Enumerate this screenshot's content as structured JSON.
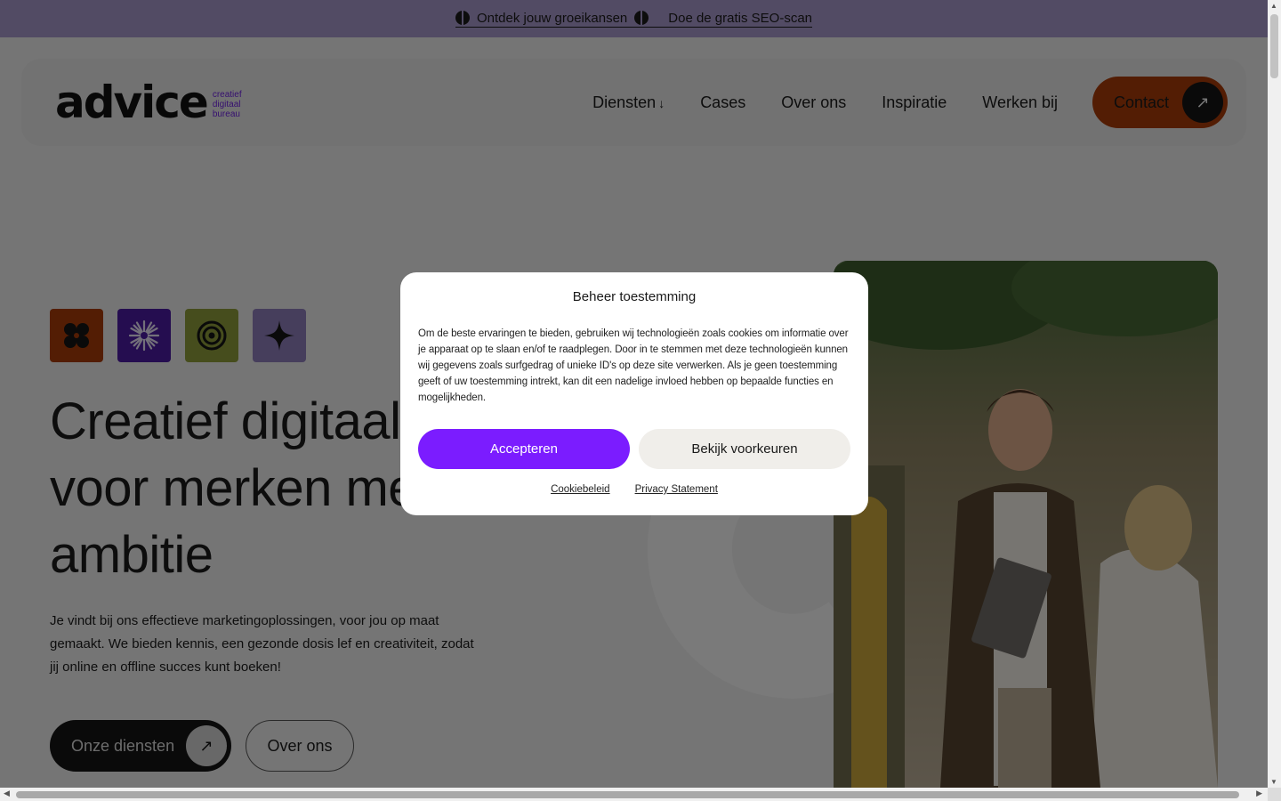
{
  "topbar": {
    "promo_text": "Ontdek jouw groeikansen",
    "link_text": "Doe de gratis SEO-scan",
    "bg_color": "#a596c8"
  },
  "header": {
    "logo_word": "advice",
    "logo_sub": [
      "creatief",
      "digitaal",
      "bureau"
    ],
    "nav": [
      {
        "label": "Diensten",
        "has_dropdown": true
      },
      {
        "label": "Cases"
      },
      {
        "label": "Over ons"
      },
      {
        "label": "Inspiratie"
      },
      {
        "label": "Werken bij"
      }
    ],
    "contact_label": "Contact"
  },
  "hero": {
    "title": "Creatief digitaal bureau voor merken met ambitie",
    "title_lines": [
      "Creatief digitaal",
      "voor merken met",
      "ambitie"
    ],
    "text": "Je vindt bij ons effectieve marketingoplossingen, voor jou op maat gemaakt. We bieden kennis, een gezonde dosis lef en creativiteit, zodat jij online en offline succes kunt boeken!",
    "primary_button": "Onze diensten",
    "secondary_button": "Over ons",
    "tile_icons": [
      "flower-icon",
      "burst-icon",
      "target-icon",
      "sparkle-icon"
    ]
  },
  "consent": {
    "title": "Beheer toestemming",
    "body": "Om de beste ervaringen te bieden, gebruiken wij technologieën zoals cookies om informatie over je apparaat op te slaan en/of te raadplegen. Door in te stemmen met deze technologieën kunnen wij gegevens zoals surfgedrag of unieke ID's op deze site verwerken. Als je geen toestemming geeft of uw toestemming intrekt, kan dit een nadelige invloed hebben op bepaalde functies en mogelijkheden.",
    "accept_label": "Accepteren",
    "prefs_label": "Bekijk voorkeuren",
    "links": [
      "Cookiebeleid",
      "Privacy Statement"
    ],
    "accent_color": "#7b1cff"
  }
}
